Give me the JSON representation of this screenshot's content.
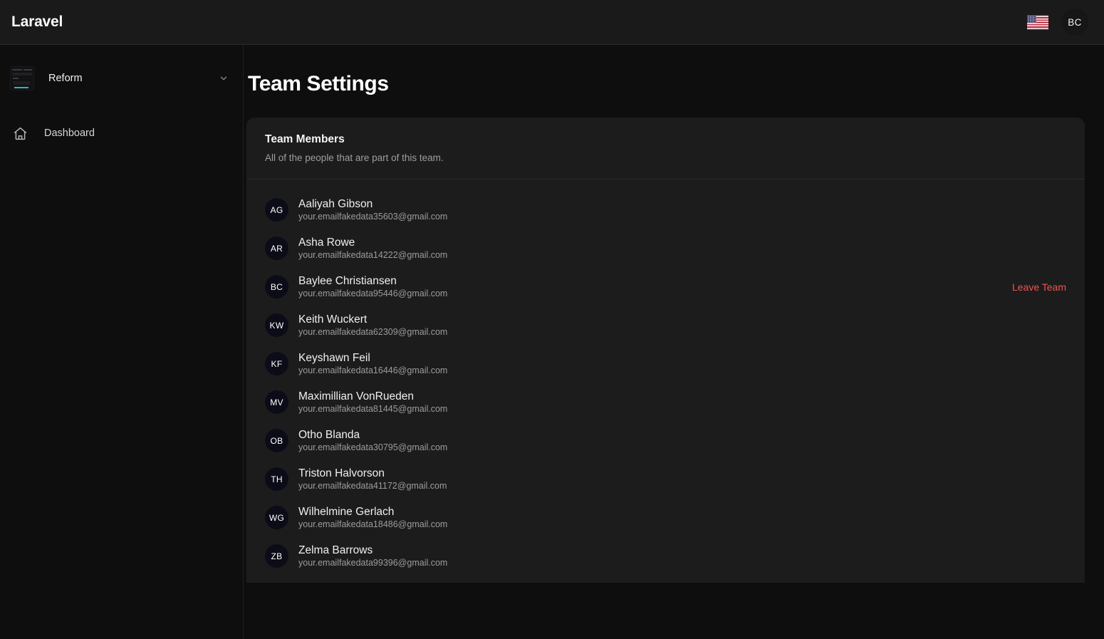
{
  "topbar": {
    "brand": "Laravel",
    "language_flag": "us-flag-icon",
    "user_initials": "BC"
  },
  "sidebar": {
    "team": {
      "name": "Reform",
      "thumbnail": "team-thumbnail-icon",
      "chevron": "chevron-down-icon"
    },
    "nav": [
      {
        "label": "Dashboard",
        "icon": "home-icon"
      }
    ]
  },
  "main": {
    "page_title": "Team Settings",
    "card": {
      "title": "Team Members",
      "subtitle": "All of the people that are part of this team."
    },
    "leave_team_label": "Leave Team",
    "members": [
      {
        "initials": "AG",
        "name": "Aaliyah Gibson",
        "email": "your.emailfakedata35603@gmail.com",
        "action": false
      },
      {
        "initials": "AR",
        "name": "Asha Rowe",
        "email": "your.emailfakedata14222@gmail.com",
        "action": false
      },
      {
        "initials": "BC",
        "name": "Baylee Christiansen",
        "email": "your.emailfakedata95446@gmail.com",
        "action": true
      },
      {
        "initials": "KW",
        "name": "Keith Wuckert",
        "email": "your.emailfakedata62309@gmail.com",
        "action": false
      },
      {
        "initials": "KF",
        "name": "Keyshawn Feil",
        "email": "your.emailfakedata16446@gmail.com",
        "action": false
      },
      {
        "initials": "MV",
        "name": "Maximillian VonRueden",
        "email": "your.emailfakedata81445@gmail.com",
        "action": false
      },
      {
        "initials": "OB",
        "name": "Otho Blanda",
        "email": "your.emailfakedata30795@gmail.com",
        "action": false
      },
      {
        "initials": "TH",
        "name": "Triston Halvorson",
        "email": "your.emailfakedata41172@gmail.com",
        "action": false
      },
      {
        "initials": "WG",
        "name": "Wilhelmine Gerlach",
        "email": "your.emailfakedata18486@gmail.com",
        "action": false
      },
      {
        "initials": "ZB",
        "name": "Zelma Barrows",
        "email": "your.emailfakedata99396@gmail.com",
        "action": false
      }
    ]
  },
  "colors": {
    "page_bg": "#0e0e0e",
    "topbar_bg": "#1a1a1a",
    "card_bg": "#1c1c1c",
    "danger": "#f05252",
    "avatar_bg": "#0c0c18"
  }
}
